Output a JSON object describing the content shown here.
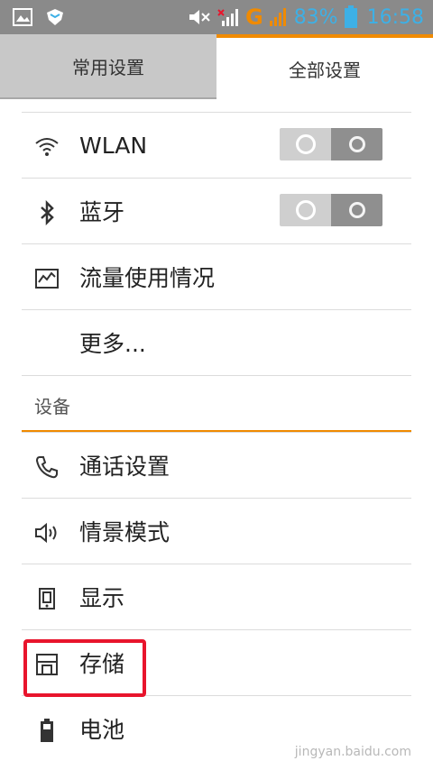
{
  "status_bar": {
    "signal_letter": "G",
    "battery_percent": "83%",
    "time": "16:58",
    "colors": {
      "bg": "#8a8a8a",
      "accent_orange": "#f08a00",
      "accent_blue": "#3db0e6"
    }
  },
  "tabs": [
    {
      "label": "常用设置",
      "selected": false
    },
    {
      "label": "全部设置",
      "selected": true
    }
  ],
  "wireless": [
    {
      "label": "WLAN",
      "icon": "wifi-icon",
      "toggle": true
    },
    {
      "label": "蓝牙",
      "icon": "bluetooth-icon",
      "toggle": true
    },
    {
      "label": "流量使用情况",
      "icon": "data-usage-icon"
    },
    {
      "label": "更多...",
      "icon": ""
    }
  ],
  "device": {
    "title": "设备",
    "items": [
      {
        "label": "通话设置",
        "icon": "phone-icon"
      },
      {
        "label": "情景模式",
        "icon": "speaker-icon"
      },
      {
        "label": "显示",
        "icon": "display-icon"
      },
      {
        "label": "存储",
        "icon": "storage-icon",
        "highlighted": true
      },
      {
        "label": "电池",
        "icon": "battery-icon"
      }
    ]
  },
  "watermark": "jingyan.baidu.com"
}
